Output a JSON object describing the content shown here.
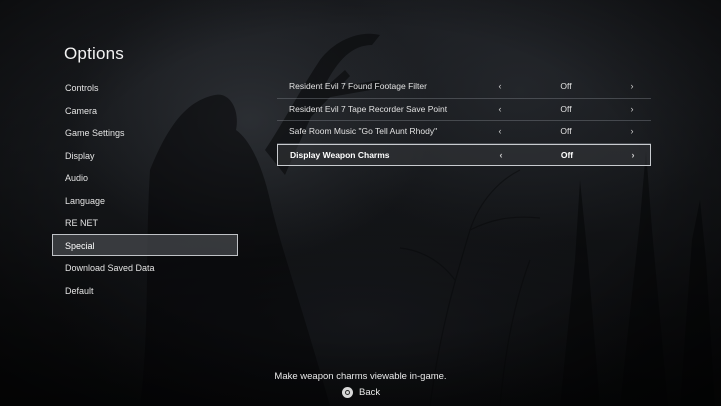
{
  "header": {
    "title": "Options"
  },
  "menu": {
    "items": [
      {
        "label": "Controls"
      },
      {
        "label": "Camera"
      },
      {
        "label": "Game Settings"
      },
      {
        "label": "Display"
      },
      {
        "label": "Audio"
      },
      {
        "label": "Language"
      },
      {
        "label": "RE NET"
      },
      {
        "label": "Special"
      },
      {
        "label": "Download Saved Data"
      },
      {
        "label": "Default"
      }
    ],
    "selected_index": 7
  },
  "options": {
    "rows": [
      {
        "label": "Resident Evil 7 Found Footage Filter",
        "left_arrow": "‹",
        "value": "Off",
        "right_arrow": "›"
      },
      {
        "label": "Resident Evil 7 Tape Recorder Save Point",
        "left_arrow": "‹",
        "value": "Off",
        "right_arrow": "›"
      },
      {
        "label": "Safe Room Music \"Go Tell Aunt Rhody\"",
        "left_arrow": "‹",
        "value": "Off",
        "right_arrow": "›"
      },
      {
        "label": "Display Weapon Charms",
        "left_arrow": "‹",
        "value": "Off",
        "right_arrow": "›"
      }
    ],
    "selected_index": 3
  },
  "footer": {
    "hint": "Make weapon charms viewable in-game.",
    "back_label": "Back",
    "back_icon": "circle-button-icon"
  },
  "colors": {
    "highlight_border": "#c8cbcf",
    "highlight_fill": "#46484c"
  }
}
